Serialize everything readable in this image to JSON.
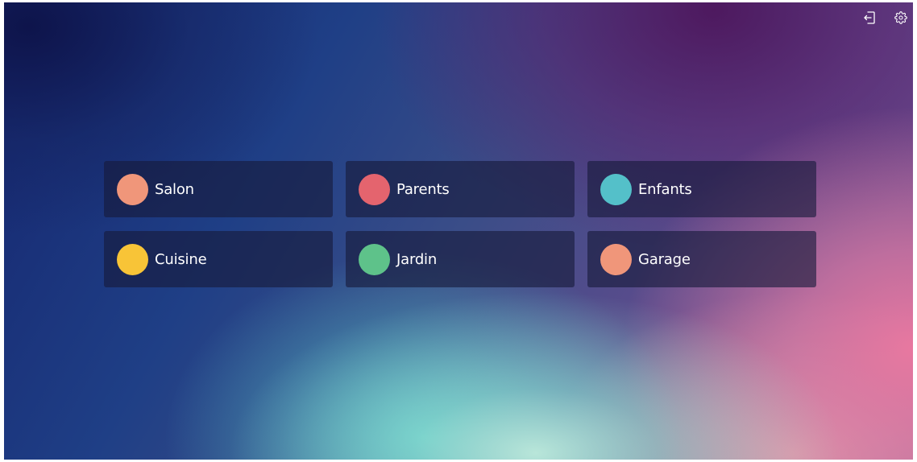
{
  "header": {
    "icons": [
      {
        "name": "logout-icon"
      },
      {
        "name": "settings-icon"
      }
    ]
  },
  "rooms": [
    {
      "label": "Salon",
      "color": "#f0967a"
    },
    {
      "label": "Parents",
      "color": "#e4646e"
    },
    {
      "label": "Enfants",
      "color": "#54c0c9"
    },
    {
      "label": "Cuisine",
      "color": "#f8c437"
    },
    {
      "label": "Jardin",
      "color": "#5ec28a"
    },
    {
      "label": "Garage",
      "color": "#f0967a"
    }
  ]
}
